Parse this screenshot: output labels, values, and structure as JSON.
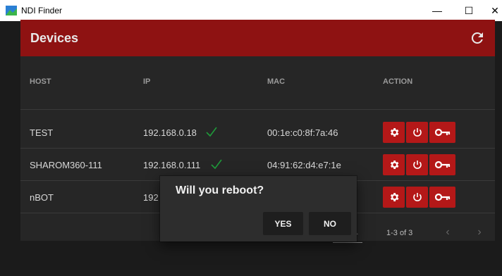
{
  "window": {
    "title": "NDI Finder",
    "minimize_label": "—",
    "maximize_label": "☐",
    "close_label": "✕"
  },
  "card": {
    "title": "Devices",
    "columns": [
      "HOST",
      "IP",
      "MAC",
      "ACTION"
    ]
  },
  "devices": [
    {
      "host": "TEST",
      "ip": "192.168.0.18",
      "mac": "00:1e:c0:8f:7a:46",
      "ip_ok": true
    },
    {
      "host": "SHAROM360-111",
      "ip": "192.168.0.111",
      "mac": "04:91:62:d4:e7:1e",
      "ip_ok": true
    },
    {
      "host": "nBOT",
      "ip": "192",
      "mac": "",
      "ip_ok": false
    }
  ],
  "footer": {
    "range": "1-3 of 3",
    "rows_select_fragment": ".",
    "prev_label": "‹",
    "next_label": "›"
  },
  "dialog": {
    "title": "Will you reboot?",
    "yes_label": "YES",
    "no_label": "NO"
  },
  "colors": {
    "accent_red": "#8e1212",
    "action_red": "#b41818",
    "check_green": "#1f9a3a",
    "background": "#1b1b1b"
  },
  "icons": {
    "refresh": "refresh-icon",
    "gear": "gear-icon",
    "power": "power-icon",
    "key": "key-icon",
    "check": "check-icon"
  }
}
